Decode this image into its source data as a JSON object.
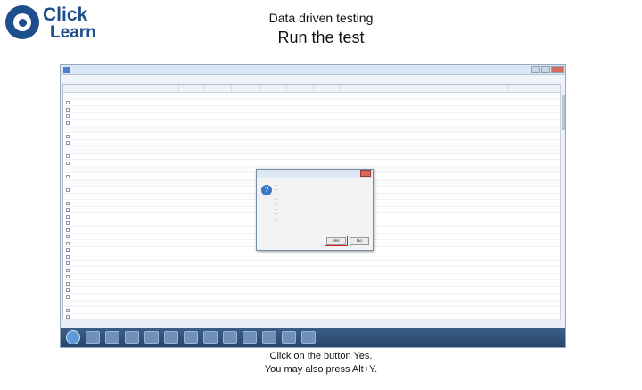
{
  "slide": {
    "logo_word1": "Click",
    "logo_word2": "Learn",
    "subtitle": "Data driven testing",
    "title": "Run the test",
    "caption_line1": "Click on the button Yes.",
    "caption_line2": "You may also press Alt+Y."
  },
  "colors": {
    "brand": "#1f4e8c",
    "highlight": "#d02020"
  },
  "dialog": {
    "text_lines": [
      "...",
      "...",
      "...",
      "...",
      "...",
      "...",
      "...",
      "..."
    ],
    "yes_label": "Yes",
    "no_label": "No"
  }
}
